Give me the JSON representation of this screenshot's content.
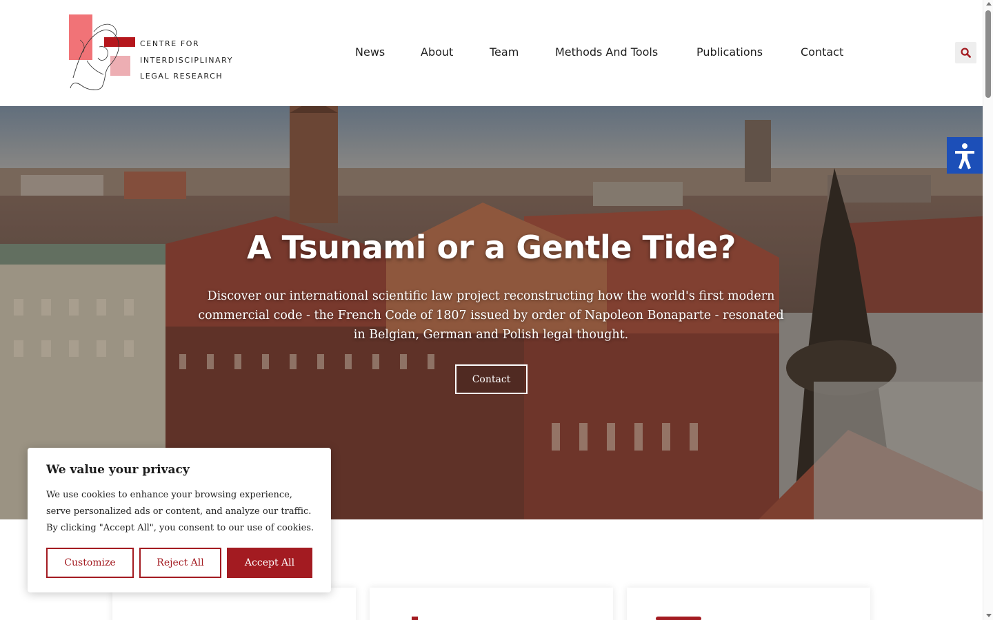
{
  "logo": {
    "lines": [
      "CENTRE FOR",
      "INTERDISCIPLINARY",
      "LEGAL RESEARCH"
    ]
  },
  "nav": {
    "items": [
      "News",
      "About",
      "Team",
      "Methods And Tools",
      "Publications",
      "Contact"
    ]
  },
  "icons": {
    "search": "search-icon",
    "accessibility": "accessibility-icon"
  },
  "hero": {
    "title": "A Tsunami or a Gentle Tide?",
    "text": "Discover our international scientific law project reconstructing how the world's first modern commercial code - the French Code of 1807 issued by order of Napoleon Bonaparte - resonated in Belgian, German and Polish legal thought.",
    "button": "Contact"
  },
  "cookie": {
    "title": "We value your privacy",
    "text": "We use cookies to enhance your browsing experience, serve personalized ads or content, and analyze our traffic. By clicking \"Accept All\", you consent to our use of cookies.",
    "customize": "Customize",
    "reject": "Reject All",
    "accept": "Accept All"
  },
  "colors": {
    "brand": "#a31b21",
    "accessibility": "#1c4fb8"
  }
}
